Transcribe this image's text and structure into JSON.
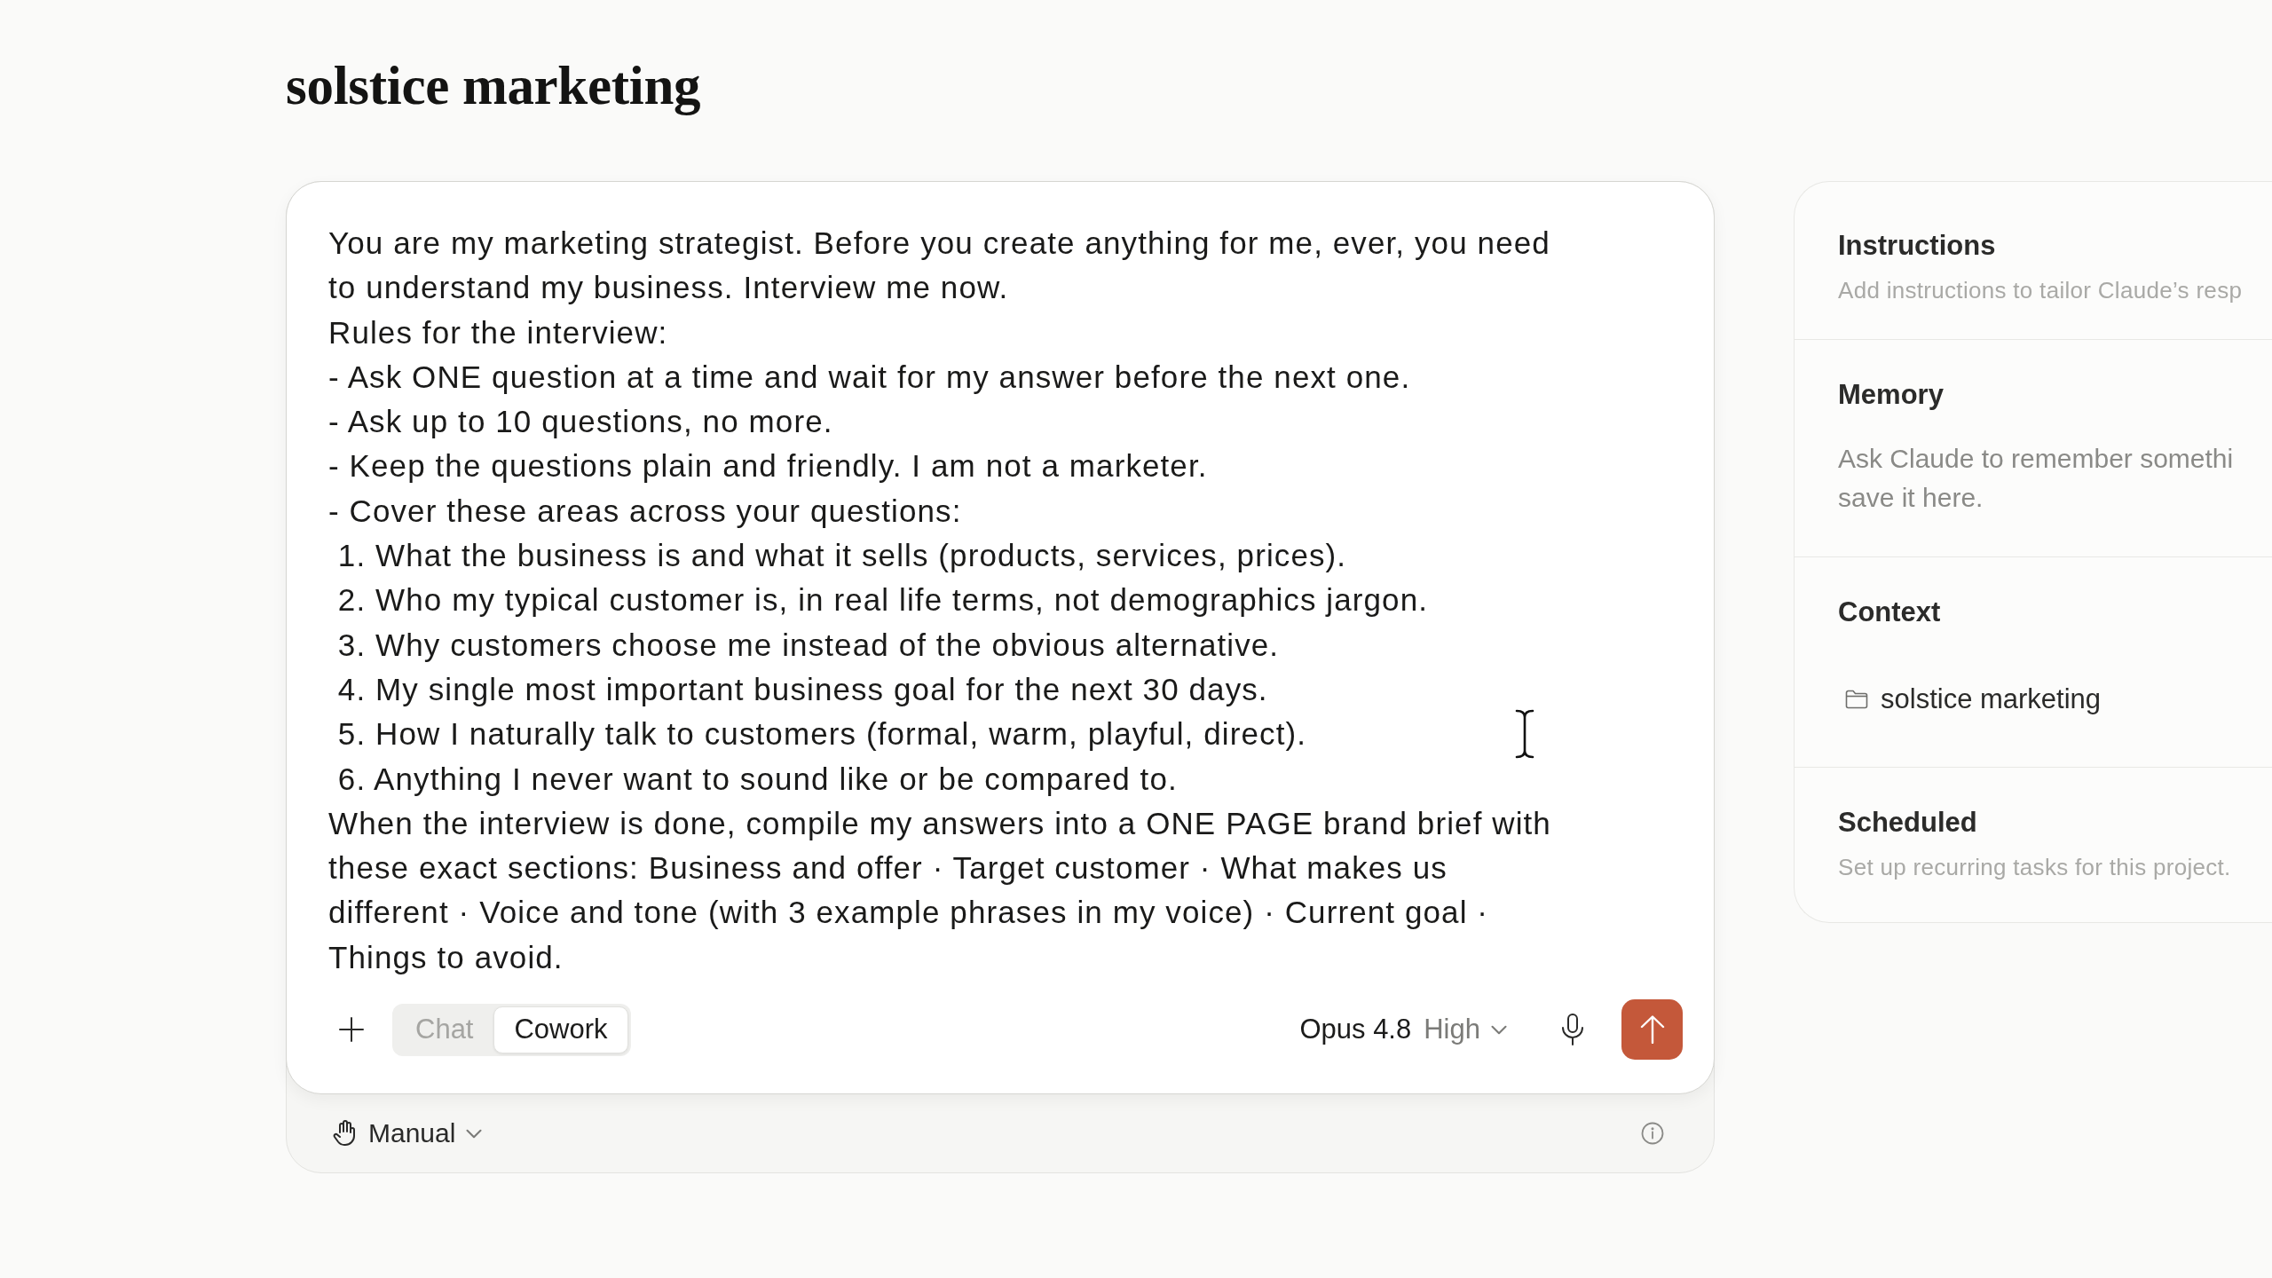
{
  "page": {
    "title": "solstice marketing"
  },
  "composer": {
    "prompt_lines": [
      "You are my marketing strategist. Before you create anything for me, ever, you need",
      "to understand my business. Interview me now.",
      "Rules for the interview:",
      "- Ask ONE question at a time and wait for my answer before the next one.",
      "- Ask up to 10 questions, no more.",
      "- Keep the questions plain and friendly. I am not a marketer.",
      "- Cover these areas across your questions:",
      " 1. What the business is and what it sells (products, services, prices).",
      " 2. Who my typical customer is, in real life terms, not demographics jargon.",
      " 3. Why customers choose me instead of the obvious alternative.",
      " 4. My single most important business goal for the next 30 days.",
      " 5. How I naturally talk to customers (formal, warm, playful, direct).",
      " 6. Anything I never want to sound like or be compared to.",
      "When the interview is done, compile my answers into a ONE PAGE brand brief with",
      "these exact sections: Business and offer · Target customer · What makes us",
      "different · Voice and tone (with 3 example phrases in my voice) · Current goal ·",
      "Things to avoid."
    ],
    "mode_toggle": [
      {
        "label": "Chat",
        "selected": false
      },
      {
        "label": "Cowork",
        "selected": true
      }
    ],
    "model": {
      "name": "Opus 4.8",
      "effort": "High"
    },
    "footer": {
      "permission_mode": "Manual"
    }
  },
  "side_panel": {
    "sections": [
      {
        "kind": "hint",
        "title": "Instructions",
        "description_lines": [
          "Add instructions to tailor Claude’s resp"
        ]
      },
      {
        "kind": "note",
        "title": "Memory",
        "description_lines": [
          "Ask Claude to remember somethi",
          "save it here."
        ]
      },
      {
        "kind": "files",
        "title": "Context",
        "items": [
          {
            "kind": "folder",
            "name": "solstice marketing"
          }
        ]
      },
      {
        "kind": "hint",
        "title": "Scheduled",
        "description_lines": [
          "Set up recurring tasks for this project."
        ]
      }
    ]
  }
}
